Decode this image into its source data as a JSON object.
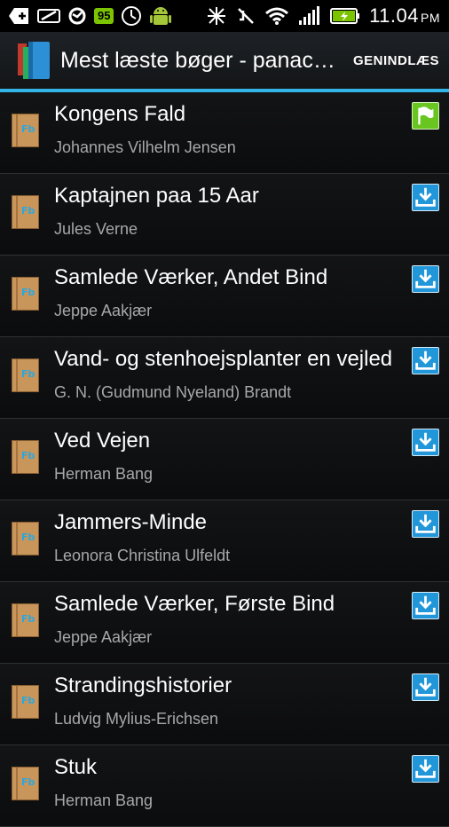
{
  "status_bar": {
    "battery_percent_badge": "95",
    "time": "11.04",
    "ampm": "PM",
    "accent_color": "#7cc400"
  },
  "action_bar": {
    "title": "Mest læste bøger - panacea",
    "reload_label": "GENINDLÆS",
    "accent_color": "#33b5e5"
  },
  "books": [
    {
      "title": "Kongens Fald",
      "author": "Johannes Vilhelm Jensen",
      "action_icon": "flag-icon"
    },
    {
      "title": "Kaptajnen paa 15 Aar",
      "author": "Jules Verne",
      "action_icon": "download-icon"
    },
    {
      "title": "Samlede Værker, Andet Bind",
      "author": "Jeppe Aakjær",
      "action_icon": "download-icon"
    },
    {
      "title": "Vand- og stenhoejsplanter en vejledning",
      "author": "G. N. (Gudmund Nyeland) Brandt",
      "action_icon": "download-icon"
    },
    {
      "title": "Ved Vejen",
      "author": "Herman Bang",
      "action_icon": "download-icon"
    },
    {
      "title": "Jammers-Minde",
      "author": "Leonora Christina Ulfeldt",
      "action_icon": "download-icon"
    },
    {
      "title": "Samlede Værker, Første Bind",
      "author": "Jeppe Aakjær",
      "action_icon": "download-icon"
    },
    {
      "title": "Strandingshistorier",
      "author": "Ludvig Mylius-Erichsen",
      "action_icon": "download-icon"
    },
    {
      "title": "Stuk",
      "author": "Herman Bang",
      "action_icon": "download-icon"
    }
  ],
  "book_badge_text": "Fb"
}
